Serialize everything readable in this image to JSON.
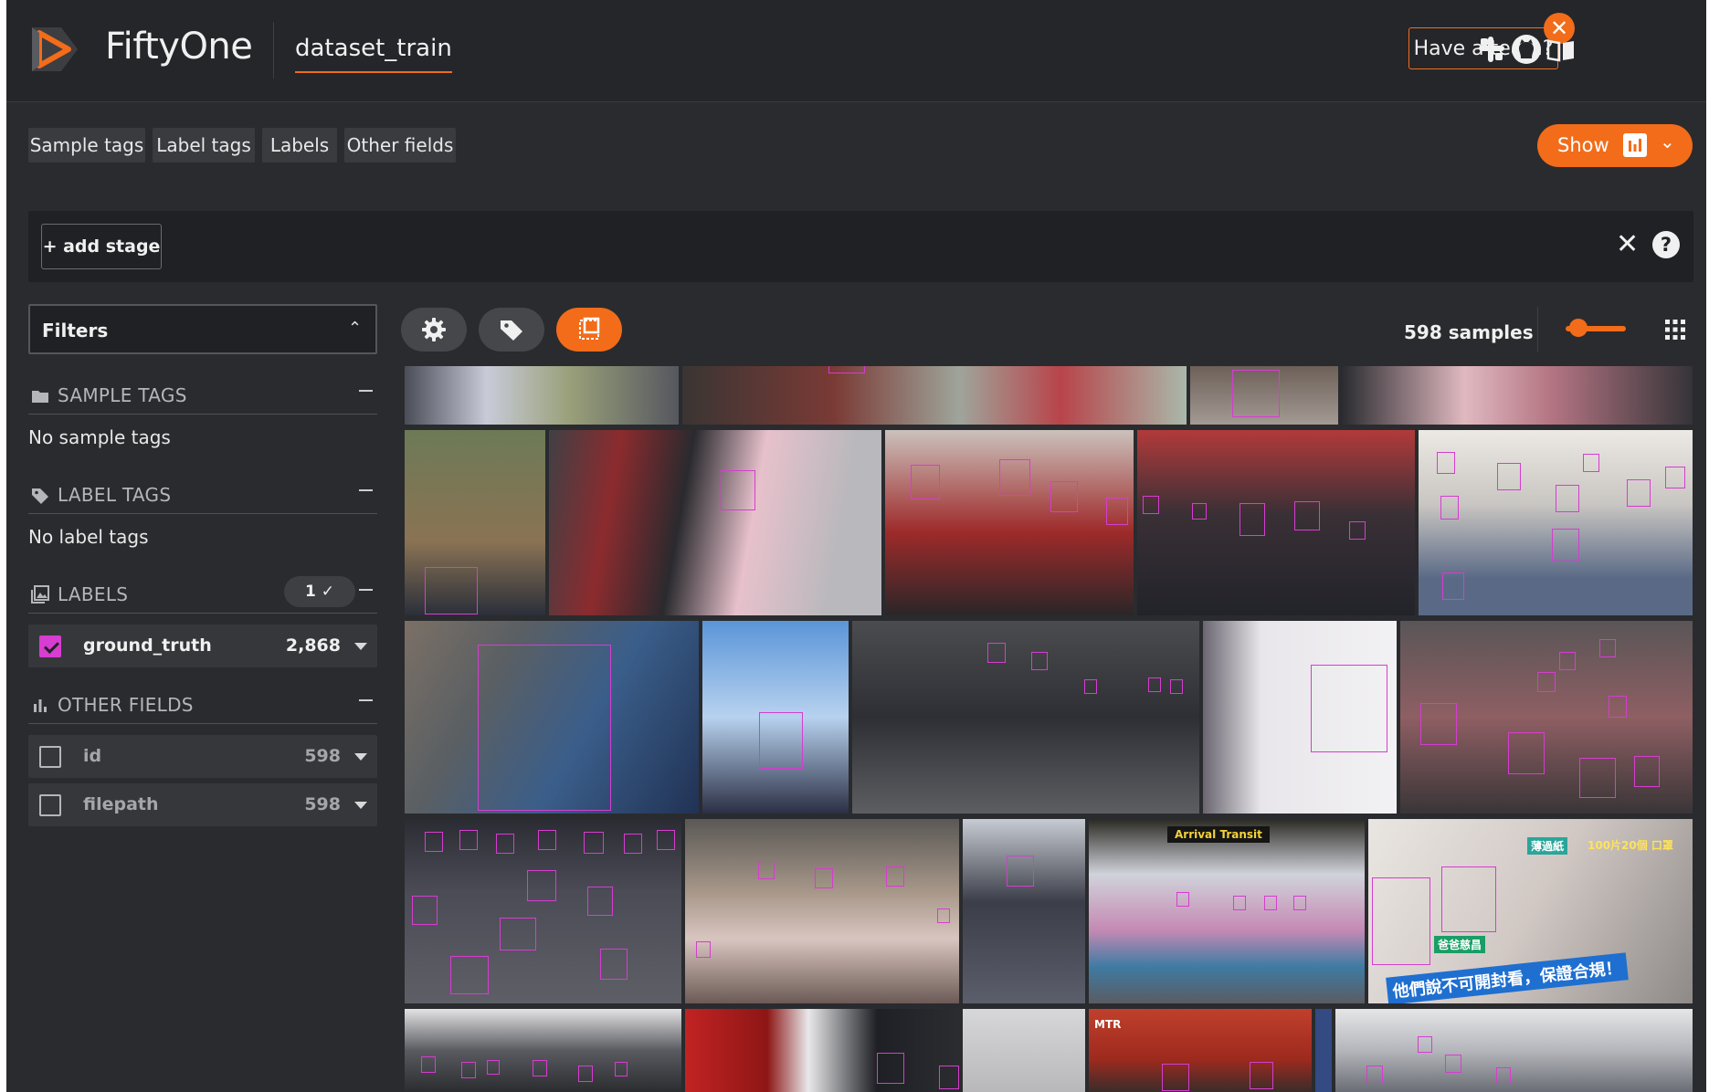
{
  "header": {
    "app_name": "FiftyOne",
    "dataset": "dataset_train",
    "team_button": "Have a team?",
    "team_close": "✕"
  },
  "field_tabs": [
    "Sample tags",
    "Label tags",
    "Labels",
    "Other fields"
  ],
  "show_button": {
    "label": "Show",
    "chevron": "⌄"
  },
  "view_bar": {
    "add_stage": "+ add stage",
    "close": "✕",
    "help": "?"
  },
  "sidebar": {
    "filters_label": "Filters",
    "filters_chevron": "⌃",
    "groups": {
      "sample_tags": {
        "title": "SAMPLE TAGS",
        "empty": "No sample tags"
      },
      "label_tags": {
        "title": "LABEL TAGS",
        "empty": "No label tags"
      },
      "labels": {
        "title": "LABELS",
        "badge": "1 ✓"
      },
      "other_fields": {
        "title": "OTHER FIELDS"
      }
    },
    "label_fields": [
      {
        "name": "ground_truth",
        "count": "2,868",
        "checked": true
      }
    ],
    "other_fields": [
      {
        "name": "id",
        "count": "598",
        "checked": false
      },
      {
        "name": "filepath",
        "count": "598",
        "checked": false
      }
    ]
  },
  "grid": {
    "count_text": "598 samples"
  },
  "tile_text": {
    "t20": "Arrival   Transit",
    "t21a": "薄過紙",
    "t21b": "100片20個 口罩",
    "t21c": "爸爸慈昌",
    "t21d": "他們說不可開封看，保證合規！",
    "t24": "MTR"
  },
  "icons": {
    "logo": "fiftyone-logo-icon",
    "slack": "slack-icon",
    "github": "github-icon",
    "docs": "book-icon",
    "settings": "gear-icon",
    "tag": "tag-icon",
    "patches": "patches-icon",
    "grid": "grid-icon"
  },
  "colors": {
    "accent": "#f26c1a",
    "label_color": "#d63dd0",
    "background": "#2a2b2e",
    "header": "#25262a"
  }
}
